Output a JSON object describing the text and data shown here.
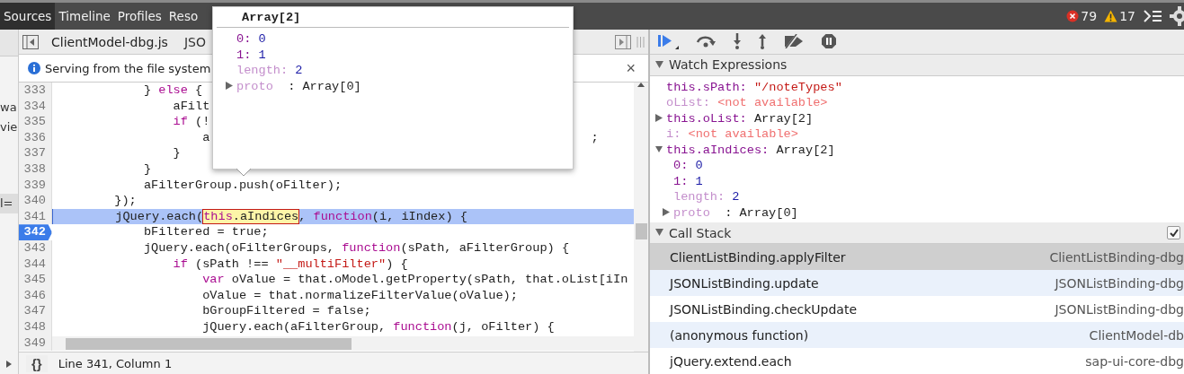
{
  "top_tabs": [
    {
      "label": "Sources",
      "selected": true
    },
    {
      "label": "Timeline",
      "selected": false
    },
    {
      "label": "Profiles",
      "selected": false
    },
    {
      "label": "Reso",
      "selected": false
    }
  ],
  "counters": {
    "errors": "79",
    "warnings": "17"
  },
  "left_strip": [
    {
      "text": "wa",
      "selected": false
    },
    {
      "text": "vie",
      "selected": false
    },
    {
      "text": "l=",
      "selected": true
    }
  ],
  "file_tabs": [
    {
      "label": "ClientModel-dbg.js",
      "selected": true
    },
    {
      "label": "JSO",
      "selected": false
    }
  ],
  "info_bar": {
    "message": "Serving from the file system",
    "close": "×"
  },
  "code_lines": [
    {
      "number": "333",
      "highlighted": false,
      "breakpoint": false,
      "segments": [
        {
          "kind": "plain",
          "text": "            } "
        },
        {
          "kind": "keyword",
          "text": "else"
        },
        {
          "kind": "plain",
          "text": " {"
        }
      ]
    },
    {
      "number": "334",
      "highlighted": false,
      "breakpoint": false,
      "segments": [
        {
          "kind": "plain",
          "text": "                aFilt"
        }
      ]
    },
    {
      "number": "335",
      "highlighted": false,
      "breakpoint": false,
      "segments": [
        {
          "kind": "keyword",
          "text": "                if"
        },
        {
          "kind": "plain",
          "text": " (!"
        }
      ]
    },
    {
      "number": "336",
      "highlighted": false,
      "breakpoint": false,
      "segments": [
        {
          "kind": "plain",
          "text": "                    a                                                    ;"
        }
      ]
    },
    {
      "number": "337",
      "highlighted": false,
      "breakpoint": false,
      "segments": [
        {
          "kind": "plain",
          "text": "                }"
        }
      ]
    },
    {
      "number": "338",
      "highlighted": false,
      "breakpoint": false,
      "segments": [
        {
          "kind": "plain",
          "text": "            }"
        }
      ]
    },
    {
      "number": "339",
      "highlighted": false,
      "breakpoint": false,
      "segments": [
        {
          "kind": "plain",
          "text": "            aFilterGroup.push(oFilter);"
        }
      ]
    },
    {
      "number": "340",
      "highlighted": false,
      "breakpoint": false,
      "segments": [
        {
          "kind": "plain",
          "text": "        });"
        }
      ]
    },
    {
      "number": "341",
      "highlighted": true,
      "breakpoint": false,
      "segments": [
        {
          "kind": "plain",
          "text": "        jQuery.each("
        },
        {
          "kind": "hover",
          "parts": [
            {
              "kind": "keyword",
              "text": "this"
            },
            {
              "kind": "plain",
              "text": ".aIndices"
            }
          ]
        },
        {
          "kind": "plain",
          "text": ", "
        },
        {
          "kind": "keyword",
          "text": "function"
        },
        {
          "kind": "plain",
          "text": "(i, iIndex) {"
        }
      ]
    },
    {
      "number": "342",
      "highlighted": false,
      "breakpoint": true,
      "segments": [
        {
          "kind": "plain",
          "text": "            bFiltered = true;"
        }
      ]
    },
    {
      "number": "343",
      "highlighted": false,
      "breakpoint": false,
      "segments": [
        {
          "kind": "plain",
          "text": "            jQuery.each(oFilterGroups, "
        },
        {
          "kind": "keyword",
          "text": "function"
        },
        {
          "kind": "plain",
          "text": "(sPath, aFilterGroup) {"
        }
      ]
    },
    {
      "number": "344",
      "highlighted": false,
      "breakpoint": false,
      "segments": [
        {
          "kind": "keyword",
          "text": "                if"
        },
        {
          "kind": "plain",
          "text": " (sPath !== "
        },
        {
          "kind": "string",
          "text": "\"__multiFilter\""
        },
        {
          "kind": "plain",
          "text": ") {"
        }
      ]
    },
    {
      "number": "345",
      "highlighted": false,
      "breakpoint": false,
      "segments": [
        {
          "kind": "keyword",
          "text": "                    var"
        },
        {
          "kind": "plain",
          "text": " oValue = that.oModel.getProperty(sPath, that.oList[iIn"
        }
      ]
    },
    {
      "number": "346",
      "highlighted": false,
      "breakpoint": false,
      "segments": [
        {
          "kind": "plain",
          "text": "                    oValue = that.normalizeFilterValue(oValue);"
        }
      ]
    },
    {
      "number": "347",
      "highlighted": false,
      "breakpoint": false,
      "segments": [
        {
          "kind": "plain",
          "text": "                    bGroupFiltered = false;"
        }
      ]
    },
    {
      "number": "348",
      "highlighted": false,
      "breakpoint": false,
      "segments": [
        {
          "kind": "plain",
          "text": "                    jQuery.each(aFilterGroup, "
        },
        {
          "kind": "keyword",
          "text": "function"
        },
        {
          "kind": "plain",
          "text": "(j, oFilter) {"
        }
      ]
    },
    {
      "number": "349",
      "highlighted": false,
      "breakpoint": false
    }
  ],
  "status_bar": {
    "pretty_print": "{}",
    "position": "Line 341, Column 1"
  },
  "popover": {
    "title": "Array[2]",
    "entries": [
      {
        "name": "0:",
        "value": "0",
        "kind": "number",
        "dim": false
      },
      {
        "name": "1:",
        "value": "1",
        "kind": "number",
        "dim": false
      },
      {
        "name": "length:",
        "value": "2",
        "kind": "number",
        "dim": true
      },
      {
        "name": "proto",
        "value": ": Array[0]",
        "kind": "object",
        "dim": true,
        "expanded": false
      }
    ]
  },
  "watch": {
    "title": "Watch Expressions",
    "expanded": true,
    "entries": [
      {
        "name": "this.sPath:",
        "value": "\"/noteTypes\"",
        "kind": "string",
        "dim": false
      },
      {
        "name": "oList:",
        "value": "<not available>",
        "kind": "unavailable",
        "dim": true
      },
      {
        "name": "this.oList:",
        "value": "Array[2]",
        "kind": "object",
        "dim": false,
        "expanded": false
      },
      {
        "name": "i:",
        "value": "<not available>",
        "kind": "unavailable",
        "dim": true
      },
      {
        "name": "this.aIndices:",
        "value": "Array[2]",
        "kind": "object",
        "dim": false,
        "expanded": true,
        "children": [
          {
            "name": "0:",
            "value": "0",
            "kind": "number",
            "dim": false
          },
          {
            "name": "1:",
            "value": "1",
            "kind": "number",
            "dim": false
          },
          {
            "name": "length:",
            "value": "2",
            "kind": "number",
            "dim": true
          },
          {
            "name": "proto",
            "value": ": Array[0]",
            "kind": "object",
            "dim": true,
            "expanded": false
          }
        ]
      }
    ]
  },
  "call_stack": {
    "title": "Call Stack",
    "expanded": true,
    "async_checked": true,
    "frames": [
      {
        "function": "ClientListBinding.applyFilter",
        "file": "ClientListBinding-dbg",
        "selected": true
      },
      {
        "function": "JSONListBinding.update",
        "file": "JSONListBinding-dbg",
        "selected": false
      },
      {
        "function": "JSONListBinding.checkUpdate",
        "file": "JSONListBinding-dbg",
        "selected": false
      },
      {
        "function": "(anonymous function)",
        "file": "ClientModel-db",
        "selected": false
      },
      {
        "function": "jQuery.extend.each",
        "file": "sap-ui-core-dbg",
        "selected": false
      }
    ]
  }
}
